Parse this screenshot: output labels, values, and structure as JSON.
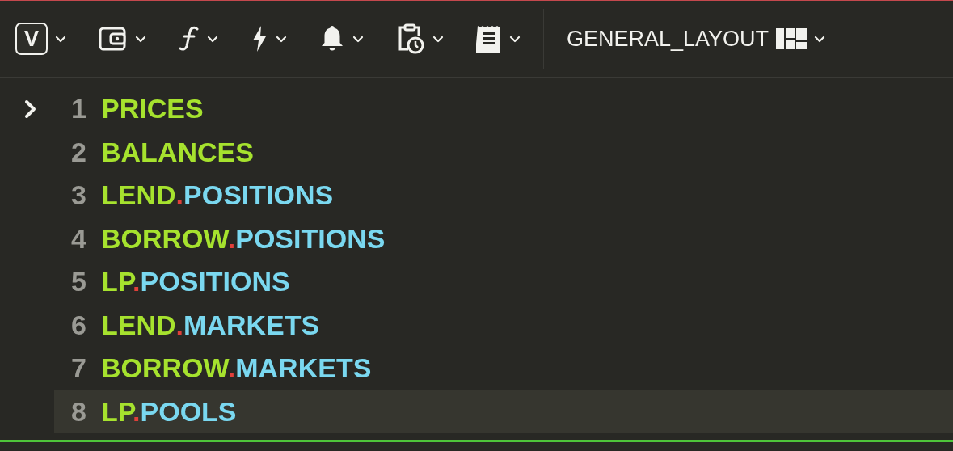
{
  "toolbar": {
    "logo_letter": "V",
    "layout_label": "GENERAL_LAYOUT"
  },
  "editor": {
    "lines": [
      {
        "number": "1",
        "head": "PRICES",
        "current": true,
        "selected": false
      },
      {
        "number": "2",
        "head": "BALANCES",
        "current": false,
        "selected": false
      },
      {
        "number": "3",
        "head": "LEND",
        "dot": ".",
        "tail": "POSITIONS",
        "current": false,
        "selected": false
      },
      {
        "number": "4",
        "head": "BORROW",
        "dot": ".",
        "tail": "POSITIONS",
        "current": false,
        "selected": false
      },
      {
        "number": "5",
        "head": "LP",
        "dot": ".",
        "tail": "POSITIONS",
        "current": false,
        "selected": false
      },
      {
        "number": "6",
        "head": "LEND",
        "dot": ".",
        "tail": "MARKETS",
        "current": false,
        "selected": false
      },
      {
        "number": "7",
        "head": "BORROW",
        "dot": ".",
        "tail": "MARKETS",
        "current": false,
        "selected": false
      },
      {
        "number": "8",
        "head": "LP",
        "dot": ".",
        "tail": "POOLS",
        "current": false,
        "selected": true
      }
    ]
  }
}
